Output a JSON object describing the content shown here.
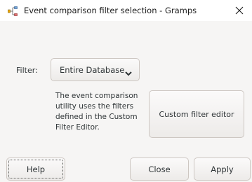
{
  "window": {
    "title": "Event comparison filter selection - Gramps",
    "app_icon": "gramps-icon",
    "close_icon": "close-icon"
  },
  "filter": {
    "label": "Filter:",
    "selected": "Entire Database",
    "dropdown_icon": "chevron-down-icon"
  },
  "description": {
    "lines": [
      "The event comparison",
      "utility uses the filters",
      "defined in the Custom",
      "Filter Editor."
    ]
  },
  "buttons": {
    "custom_filter_editor": "Custom filter editor",
    "help": "Help",
    "close": "Close",
    "apply": "Apply"
  },
  "colors": {
    "background": "#f6f5f4",
    "titlebar": "#ffffff",
    "text": "#2e3436",
    "border": "#cdc7c2"
  }
}
